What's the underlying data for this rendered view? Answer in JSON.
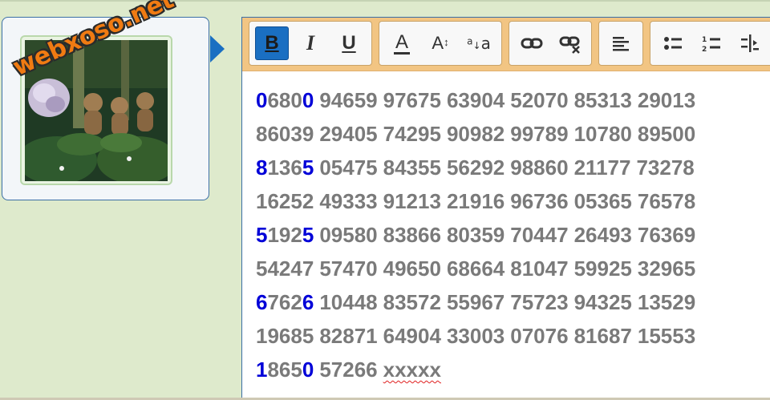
{
  "avatar": {
    "watermark": "webxoso.net",
    "image": "garden-photo"
  },
  "toolbar": {
    "bold": "B",
    "italic": "I",
    "underline": "U",
    "text_color": "A",
    "font_size": "A",
    "font_size_mark": "↕",
    "font_case_small": "a",
    "font_case_large": "a",
    "font_case_sub": "a",
    "icons": {
      "link": "link-icon",
      "unlink": "unlink-icon",
      "align": "align-left-icon",
      "bullets": "bulleted-list-icon",
      "numbers": "numbered-list-icon",
      "indent": "indent-icon"
    },
    "active_color": "#1a6fc2"
  },
  "content": {
    "highlight_color": "#0000d8",
    "lines": [
      [
        {
          "head": "0",
          "mid": "680",
          "tail": "0",
          "hl": true
        },
        "94659",
        "97675",
        "63904",
        "52070",
        "85313",
        "29013"
      ],
      [
        "86039",
        "29405",
        "74295",
        "90982",
        "99789",
        "10780",
        "89500"
      ],
      [
        {
          "head": "8",
          "mid": "136",
          "tail": "5",
          "hl": true
        },
        "05475",
        "84355",
        "56292",
        "98860",
        "21177",
        "73278"
      ],
      [
        "16252",
        "49333",
        "91213",
        "21916",
        "96736",
        "05365",
        "76578"
      ],
      [
        {
          "head": "5",
          "mid": "192",
          "tail": "5",
          "hl": true
        },
        "09580",
        "83866",
        "80359",
        "70447",
        "26493",
        "76369"
      ],
      [
        "54247",
        "57470",
        "49650",
        "68664",
        "81047",
        "59925",
        "32965"
      ],
      [
        {
          "head": "6",
          "mid": "762",
          "tail": "6",
          "hl": true
        },
        "10448",
        "83572",
        "55967",
        "75723",
        "94325",
        "13529"
      ],
      [
        "19685",
        "82871",
        "64904",
        "33003",
        "07076",
        "81687",
        "15553"
      ],
      [
        {
          "head": "1",
          "mid": "865",
          "tail": "0",
          "hl": true
        },
        "57266",
        {
          "text": "xxxxx",
          "spell": true
        }
      ]
    ]
  }
}
